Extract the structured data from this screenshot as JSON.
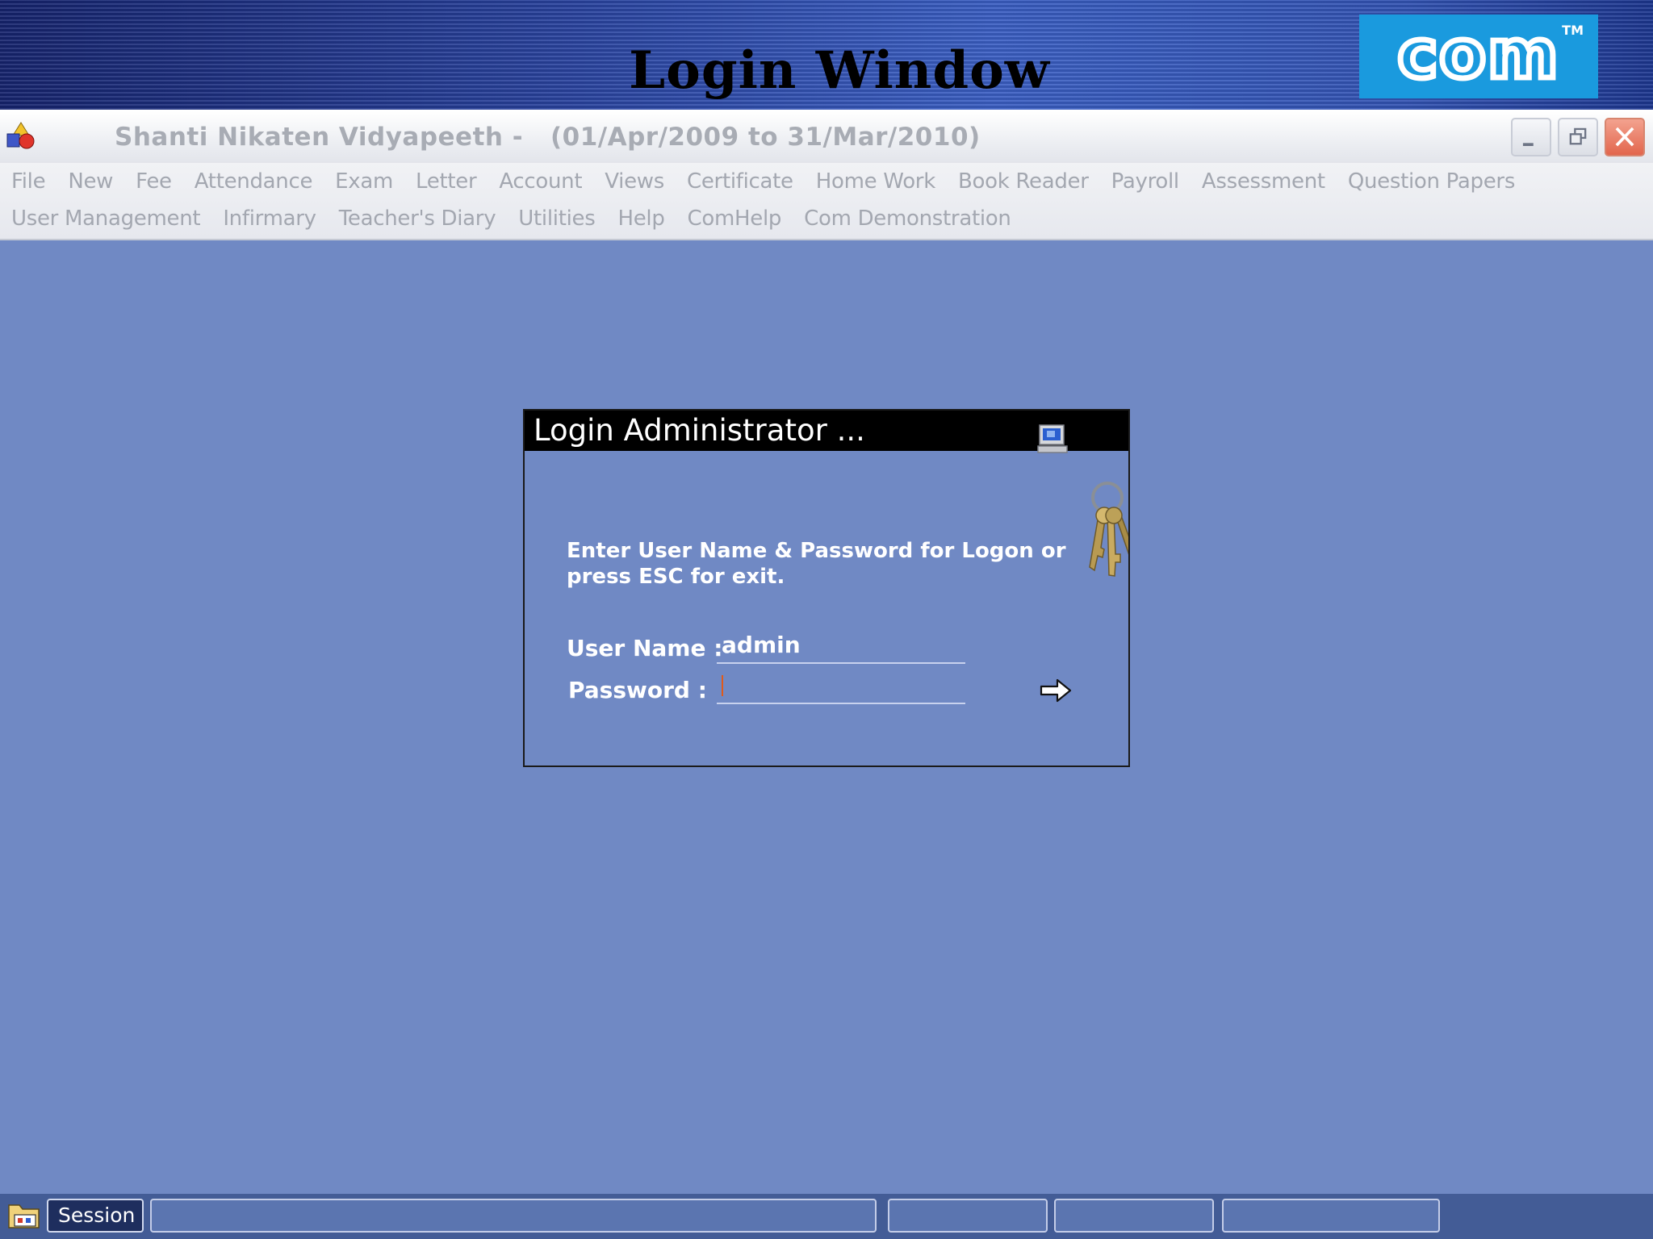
{
  "banner": {
    "title": "Login Window",
    "logo_text": "com",
    "logo_tm": "TM",
    "logo_icon": "com-logo-icon"
  },
  "titlebar": {
    "app_title": "Shanti Nikaten Vidyapeeth -   (01/Apr/2009 to 31/Mar/2010)",
    "icon": "app-shapes-icon"
  },
  "menu": {
    "row1": [
      "File",
      "New",
      "Fee",
      "Attendance",
      "Exam",
      "Letter",
      "Account",
      "Views",
      "Certificate",
      "Home Work",
      "Book Reader",
      "Payroll",
      "Assessment",
      "Question Papers"
    ],
    "row2": [
      "User Management",
      "Infirmary",
      "Teacher's Diary",
      "Utilities",
      "Help",
      "ComHelp",
      "Com Demonstration"
    ]
  },
  "dialog": {
    "title": "Login Administrator ...",
    "instruction": "Enter User Name & Password for Logon  or press ESC for exit.",
    "user_label": "User Name :",
    "user_value": "admin",
    "password_label": "Password :",
    "password_value": "",
    "icons": [
      "computer-icon",
      "keys-icon",
      "arrow-right-icon"
    ]
  },
  "taskbar": {
    "session_label": "Session",
    "icon": "folder-icon"
  },
  "colors": {
    "background": "#7089c4",
    "logo": "#1a9ade",
    "taskbar": "#435c96"
  }
}
